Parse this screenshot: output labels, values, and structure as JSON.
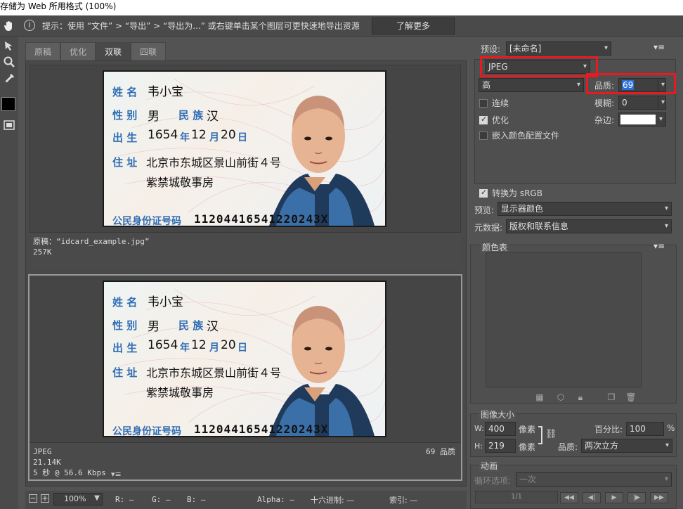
{
  "window": {
    "title": "存储为 Web 所用格式 (100%)"
  },
  "tipbar": {
    "tip": "提示：使用 “文件” > “导出” > “导出为...” 或右键单击某个图层可更快速地导出资源",
    "learn_more": "了解更多"
  },
  "tabs": [
    "原稿",
    "优化",
    "双联",
    "四联"
  ],
  "card": {
    "name_label": "姓 名",
    "name": "韦小宝",
    "sex_label": "性 别",
    "sex": "男",
    "ethnic_label": "民 族",
    "ethnic": "汉",
    "birth_label": "出 生",
    "birth_year": "1654",
    "year_unit": "年",
    "birth_month": "12",
    "month_unit": "月",
    "birth_day": "20",
    "day_unit": "日",
    "addr_label": "住 址",
    "addr_line1": "北京市东城区景山前街４号",
    "addr_line2": "紫禁城敬事房",
    "id_label": "公民身份证号码",
    "id_number": "11204416541220243X"
  },
  "original": {
    "label": "原稿：“idcard_example.jpg”",
    "size": "257K"
  },
  "optimized": {
    "format": "JPEG",
    "size": "21.14K",
    "time": "5 秒 @ 56.6 Kbps",
    "quality": "69 品质"
  },
  "statusbar": {
    "zoom": "100%",
    "r": "R: —",
    "g": "G: —",
    "b": "B: —",
    "alpha": "Alpha: —",
    "hex": "十六进制: —",
    "index": "索引: —"
  },
  "settings": {
    "preset_label": "预设:",
    "preset_value": "[未命名]",
    "format": "JPEG",
    "quality_level": "高",
    "quality_label": "品质:",
    "quality_value": "69",
    "progressive_label": "连续",
    "progressive_checked": false,
    "blur_label": "模糊:",
    "blur_value": "0",
    "optimized_label": "优化",
    "optimized_checked": true,
    "matte_label": "杂边:",
    "embed_profile_label": "嵌入颜色配置文件",
    "embed_checked": false,
    "convert_srgb_label": "转换为 sRGB",
    "convert_checked": true,
    "preview_label": "预览:",
    "preview_value": "显示器颜色",
    "metadata_label": "元数据:",
    "metadata_value": "版权和联系信息"
  },
  "color_table": {
    "title": "颜色表"
  },
  "image_size": {
    "title": "图像大小",
    "w_label": "W:",
    "w_value": "400",
    "h_label": "H:",
    "h_value": "219",
    "unit": "像素",
    "percent_label": "百分比:",
    "percent_value": "100",
    "percent_unit": "%",
    "quality_label": "品质:",
    "quality_value": "两次立方"
  },
  "animation": {
    "title": "动画",
    "loop_label": "循环选项:",
    "loop_value": "一次",
    "frame": "1/1"
  },
  "colors": {
    "accent_red": "#e8191f",
    "card_blue": "#2f6db5",
    "background": "#535353"
  }
}
